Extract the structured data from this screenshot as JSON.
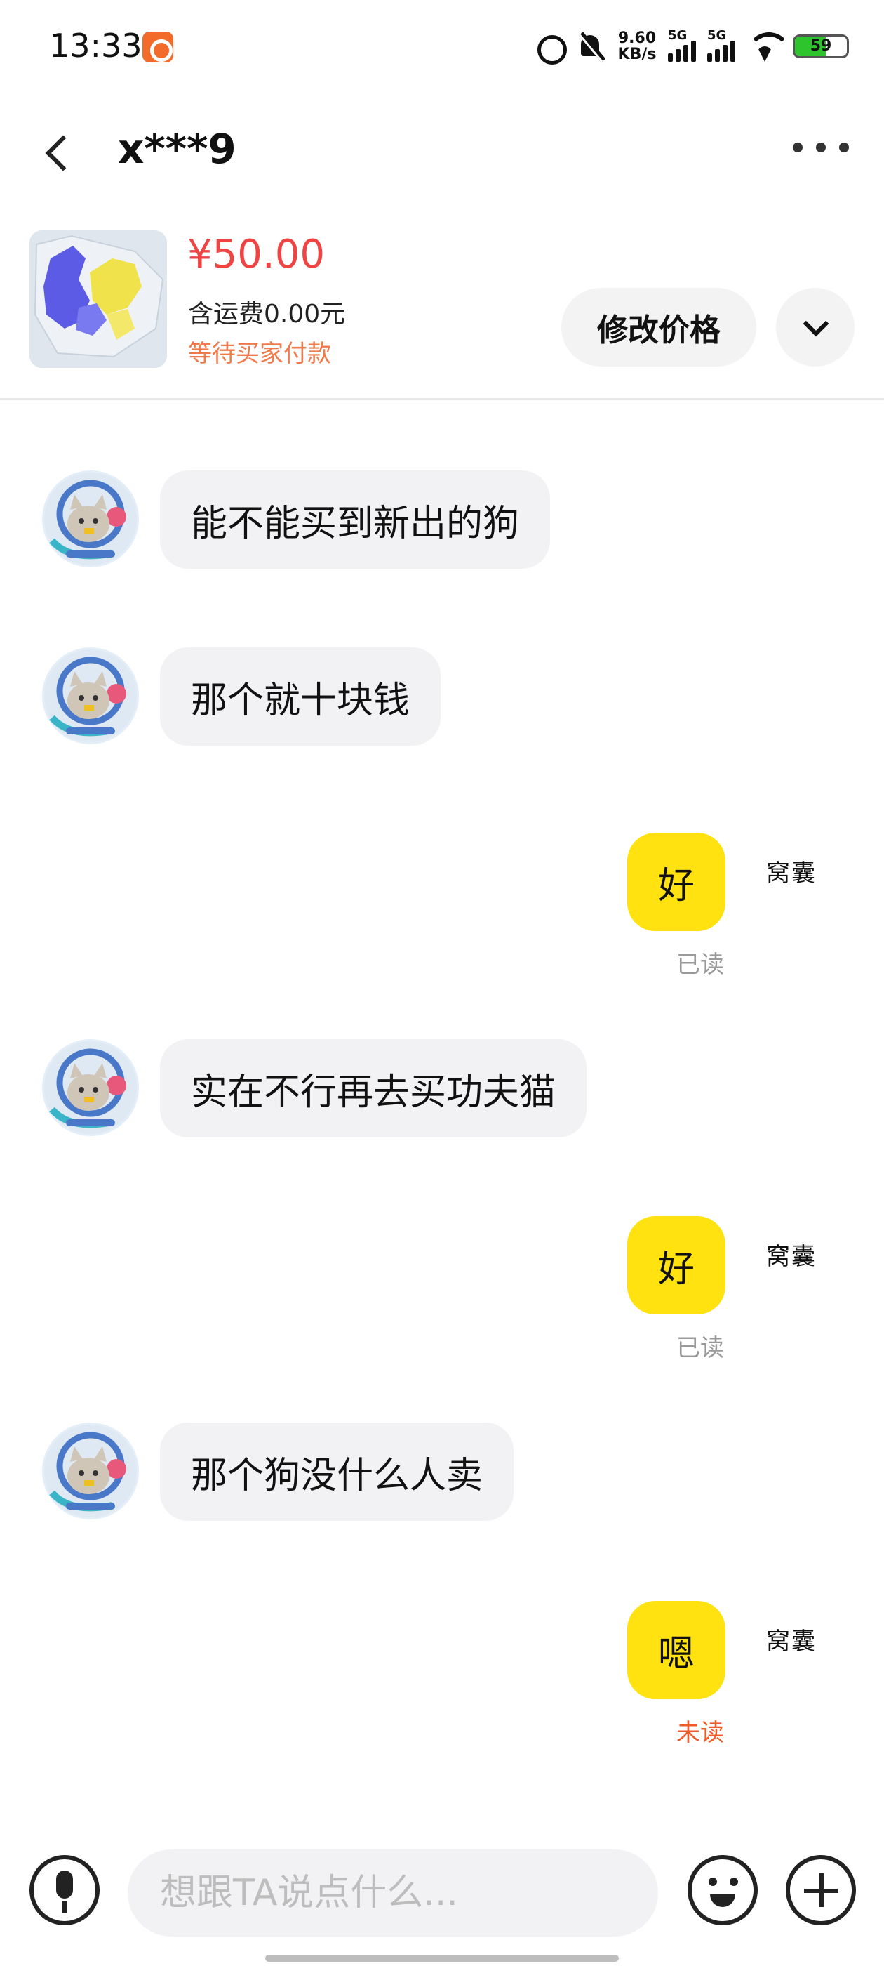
{
  "status_bar": {
    "time": "13:33",
    "net_speed_value": "9.60",
    "net_speed_unit": "KB/s",
    "signal_1_label": "5G",
    "signal_2_label": "5G",
    "battery_level": "59",
    "battery_fraction": 0.59,
    "icons": [
      "app-notification-icon",
      "alarm-icon",
      "mute-icon",
      "signal-icon",
      "signal-icon",
      "wifi-icon",
      "battery-icon"
    ]
  },
  "header": {
    "title": "x***9",
    "back_icon": "chevron-left-icon",
    "more_icon": "more-dots-icon"
  },
  "product": {
    "price": "¥50.00",
    "shipping": "含运费0.00元",
    "status": "等待买家付款",
    "edit_price_label": "修改价格",
    "expand_icon": "chevron-down-icon",
    "accent_color": "#ee4444",
    "status_color": "#f07a4a"
  },
  "messages": [
    {
      "side": "left",
      "text": "能不能买到新出的狗"
    },
    {
      "side": "left",
      "text": "那个就十块钱"
    },
    {
      "side": "right",
      "text": "好",
      "status": "已读",
      "sender_tag": "窝囊"
    },
    {
      "side": "left",
      "text": "实在不行再去买功夫猫"
    },
    {
      "side": "right",
      "text": "好",
      "status": "已读",
      "sender_tag": "窝囊"
    },
    {
      "side": "left",
      "text": "那个狗没什么人卖"
    },
    {
      "side": "right",
      "text": "嗯",
      "status": "未读",
      "sender_tag": "窝囊"
    }
  ],
  "input_bar": {
    "placeholder": "想跟TA说点什么...",
    "voice_icon": "microphone-icon",
    "emoji_icon": "emoji-icon",
    "plus_icon": "plus-icon"
  },
  "colors": {
    "my_bubble": "#ffe20f",
    "their_bubble": "#f2f2f4",
    "unread": "#f05a28",
    "read": "#999999"
  }
}
